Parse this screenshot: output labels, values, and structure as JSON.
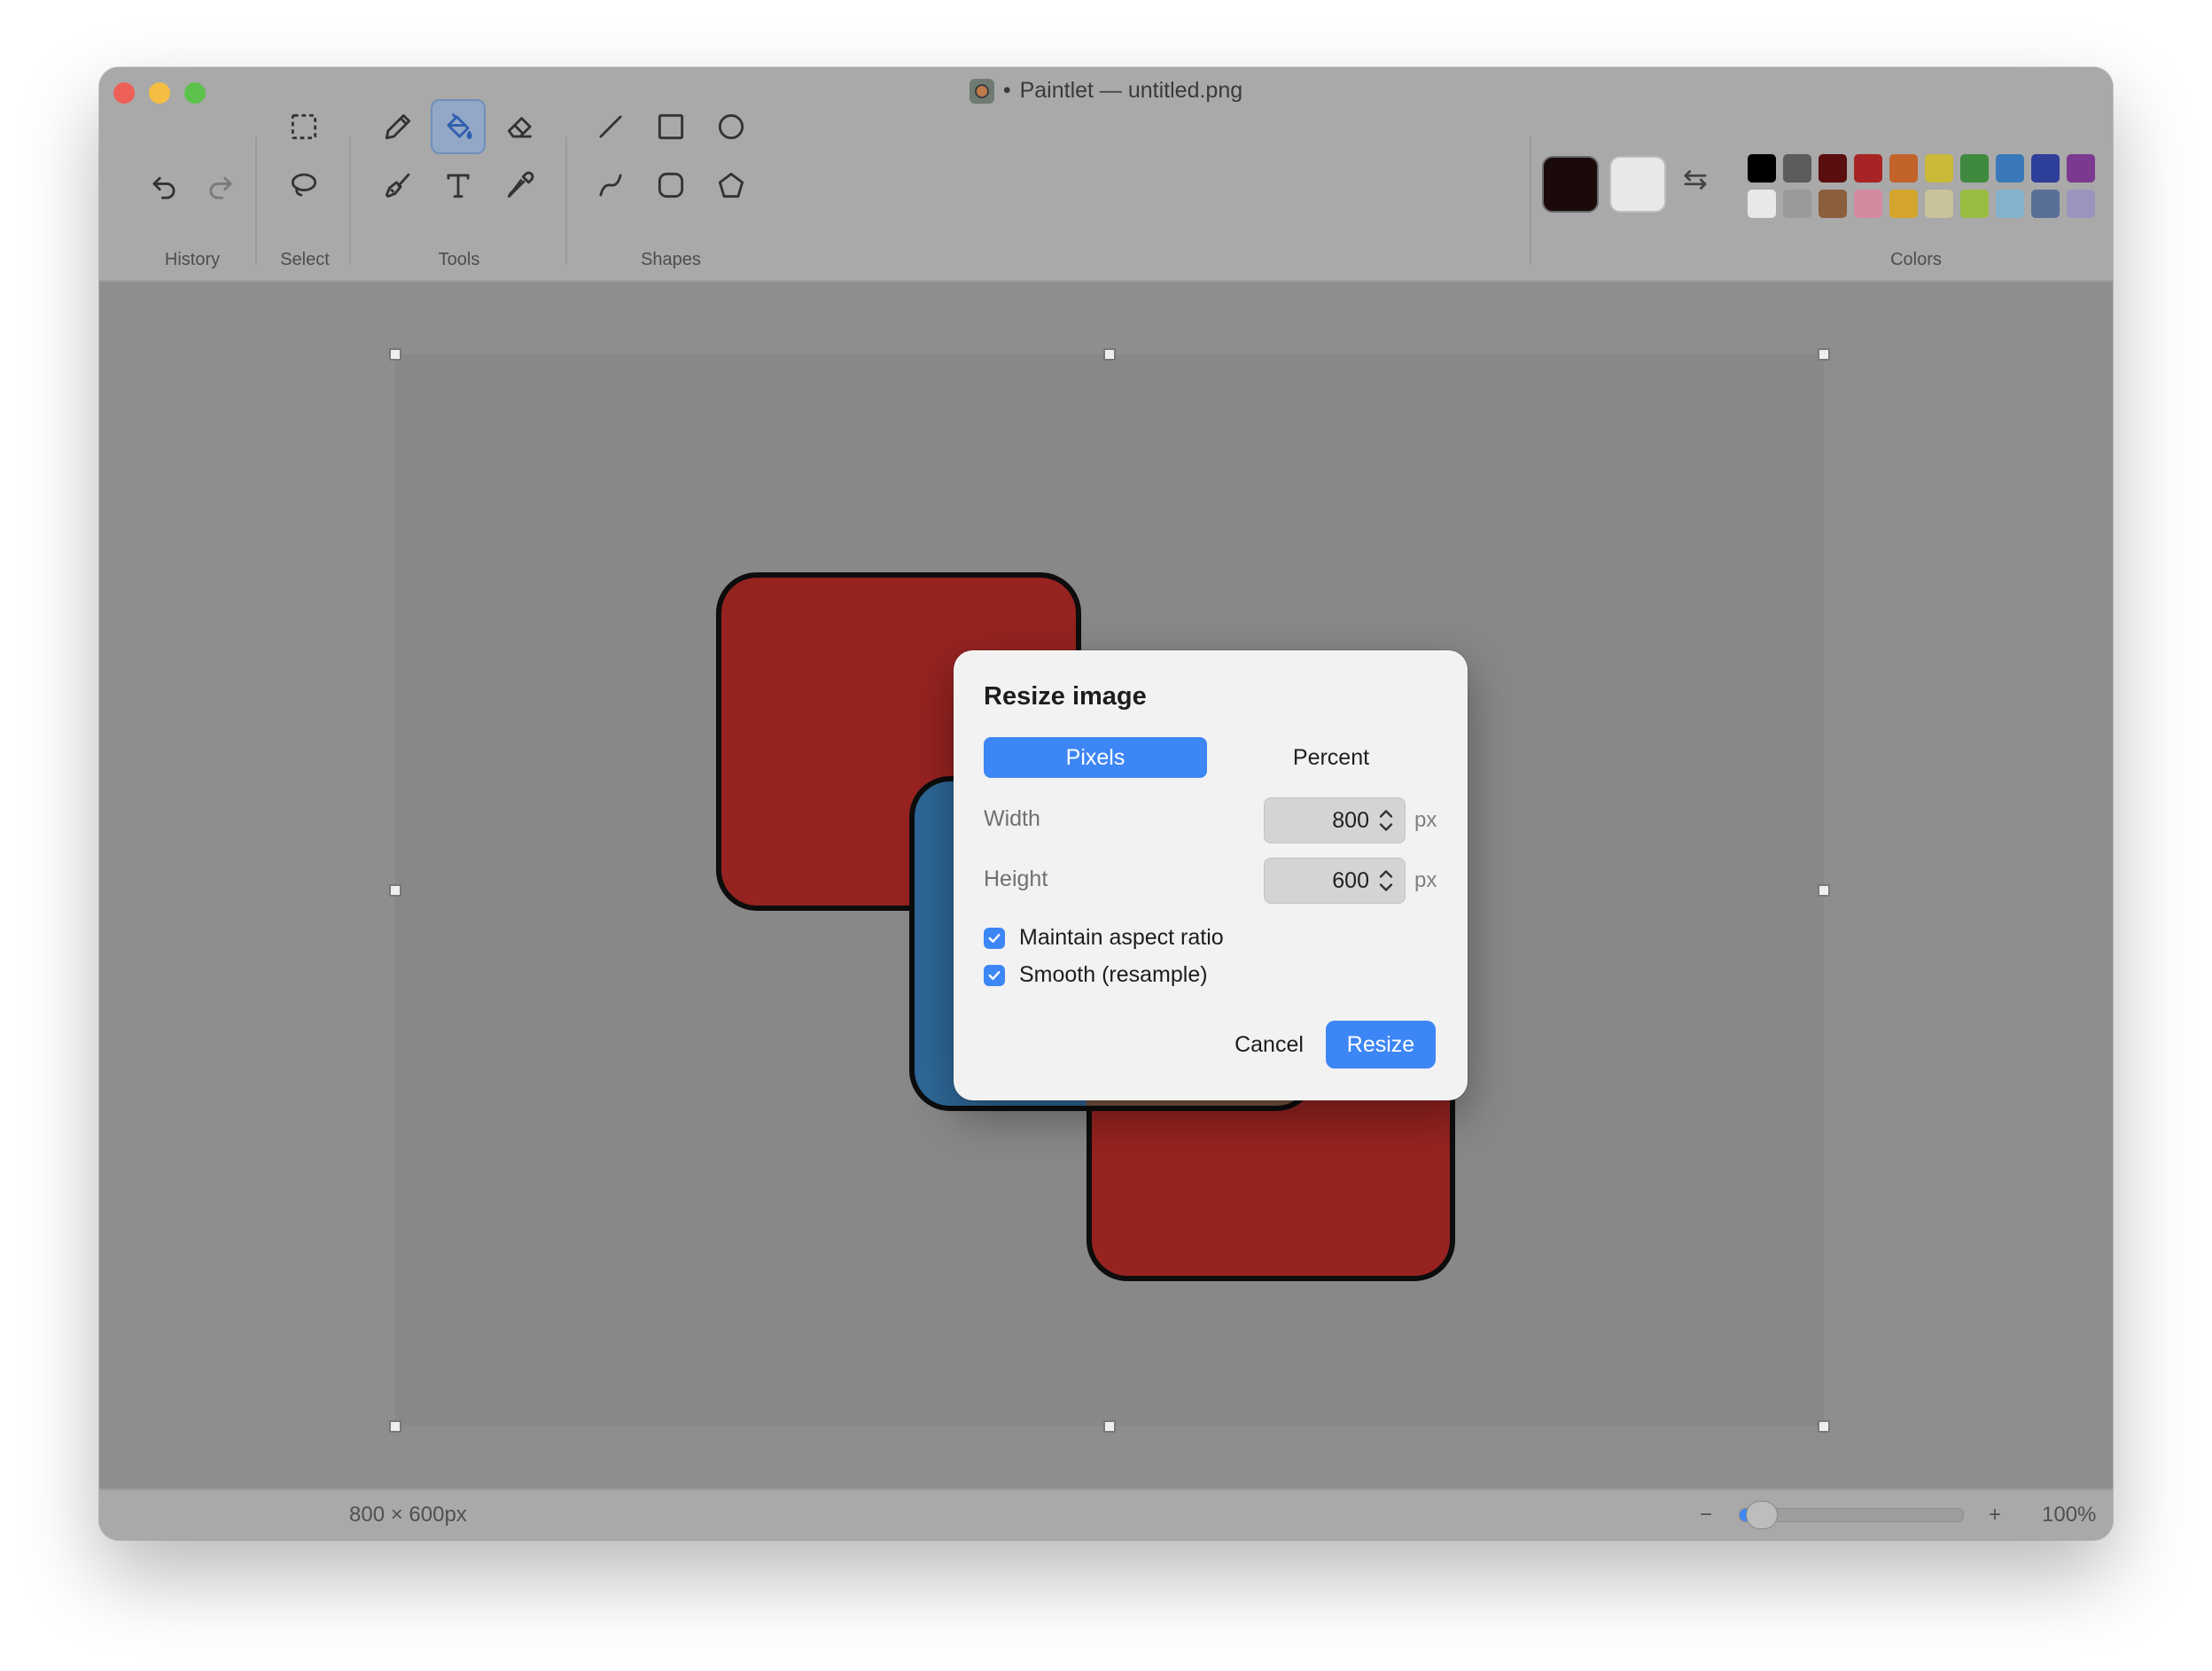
{
  "window": {
    "title": "Paintlet — untitled.png",
    "title_dot": "•"
  },
  "toolbar": {
    "groups": {
      "history": "History",
      "select": "Select",
      "tools": "Tools",
      "shapes": "Shapes",
      "colors": "Colors"
    },
    "active_tool": "fill-bucket"
  },
  "colors": {
    "primary": "#1a0a0a",
    "secondary": "#ececec",
    "palette_top": [
      "#000000",
      "#5c5c5c",
      "#5a0e0e",
      "#a82424",
      "#c2632a",
      "#cbb93a",
      "#3f8a3f",
      "#3a79b9",
      "#2d3f99",
      "#7b3a8f"
    ],
    "palette_bottom": [
      "#e8e8e8",
      "#9a9a9a",
      "#8b5e3c",
      "#d38a9e",
      "#d4a52c",
      "#c9c29a",
      "#98bc40",
      "#83b2cc",
      "#5a6f96",
      "#9b94bf"
    ]
  },
  "canvas": {
    "shape_colors": {
      "red": "#962320",
      "blue": "#2e6898",
      "brown": "#7a5540"
    }
  },
  "dialog": {
    "title": "Resize image",
    "mode_pixels": "Pixels",
    "mode_percent": "Percent",
    "width_label": "Width",
    "width_value": "800",
    "height_label": "Height",
    "height_value": "600",
    "unit": "px",
    "maintain_aspect_label": "Maintain aspect ratio",
    "maintain_aspect_checked": true,
    "smooth_label": "Smooth (resample)",
    "smooth_checked": true,
    "cancel_label": "Cancel",
    "resize_label": "Resize"
  },
  "status": {
    "dimensions": "800 × 600px",
    "zoom_minus": "−",
    "zoom_plus": "+",
    "zoom_level": "100%",
    "zoom_fraction": 0.1
  }
}
